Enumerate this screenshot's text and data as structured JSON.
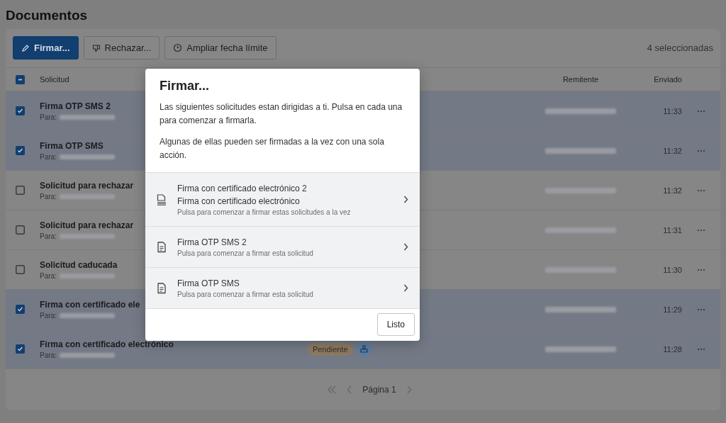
{
  "page": {
    "title": "Documentos"
  },
  "toolbar": {
    "buttons": [
      {
        "label": "Firmar...",
        "kind": "primary"
      },
      {
        "label": "Rechazar...",
        "kind": "reject"
      },
      {
        "label": "Ampliar fecha límite",
        "kind": "extend"
      }
    ],
    "selection_count": "4 seleccionadas"
  },
  "table": {
    "select_all_indeterminate": true,
    "columns": [
      "Solicitud",
      "Remitente",
      "Enviado"
    ],
    "rows": [
      {
        "title": "Firma OTP SMS 2",
        "recipient_label": "Para:",
        "sent": "11:33",
        "selected": true
      },
      {
        "title": "Firma OTP SMS",
        "recipient_label": "Para:",
        "sent": "11:32",
        "selected": true
      },
      {
        "title": "Solicitud para rechazar",
        "recipient_label": "Para:",
        "sent": "11:32",
        "selected": false
      },
      {
        "title": "Solicitud para rechazar",
        "recipient_label": "Para:",
        "sent": "11:31",
        "selected": false
      },
      {
        "title": "Solicitud caducada",
        "recipient_label": "Para:",
        "sent": "11:30",
        "selected": false
      },
      {
        "title": "Firma con certificado ele",
        "recipient_label": "Para:",
        "sent": "11:29",
        "selected": true
      },
      {
        "title": "Firma con certificado electrónico",
        "recipient_label": "Para:",
        "sent": "11:28",
        "selected": true,
        "status": "Pendiente"
      }
    ]
  },
  "pagination": {
    "label": "Página 1"
  },
  "dialog": {
    "title": "Firmar...",
    "paragraphs": [
      "Las siguientes solicitudes estan dirigidas a ti. Pulsa en cada una para comenzar a firmarla.",
      "Algunas de ellas pueden ser firmadas a la vez con una sola acción."
    ],
    "items": [
      {
        "kind": "batch",
        "titles": [
          "Firma con certificado electrónico 2",
          "Firma con certificado electrónico"
        ],
        "hint": "Pulsa para comenzar a firmar estas solicitudes a la vez"
      },
      {
        "kind": "single",
        "titles": [
          "Firma OTP SMS 2"
        ],
        "hint": "Pulsa para comenzar a firmar esta solicitud"
      },
      {
        "kind": "single",
        "titles": [
          "Firma OTP SMS"
        ],
        "hint": "Pulsa para comenzar a firmar esta solicitud"
      }
    ],
    "done_button": "Listo"
  }
}
